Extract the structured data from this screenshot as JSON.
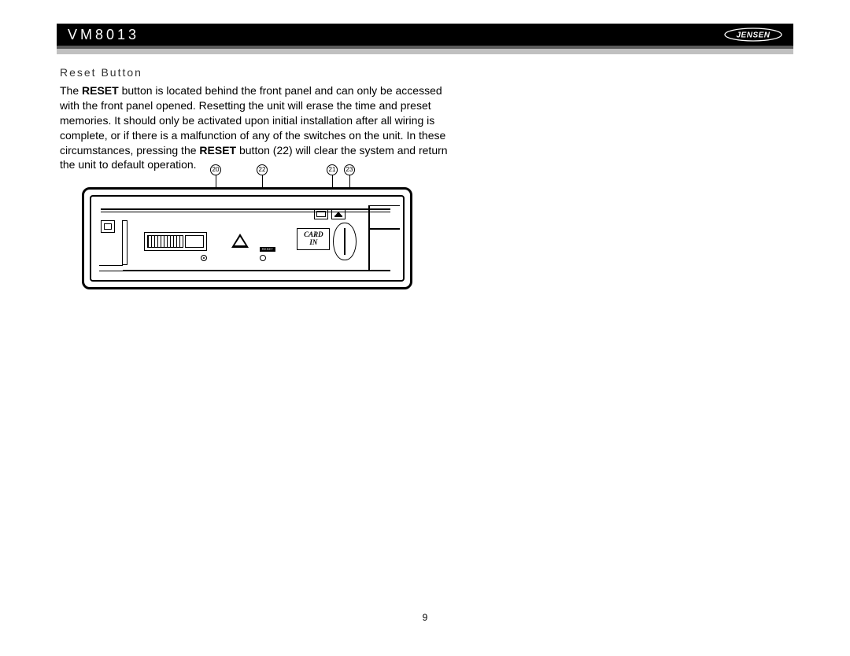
{
  "header": {
    "model": "VM8013",
    "brand": "JENSEN"
  },
  "section": {
    "heading": "Reset Button",
    "para_pre": "The ",
    "bold1": "RESET",
    "para_mid": " button is located behind the front panel and can only be accessed with the front panel opened. Resetting the unit will erase the time and preset memories. It should only be activated upon initial installation after all wiring is complete, or if there is a malfunction of any of the switches on the unit. In these circumstances, pressing the ",
    "bold2": "RESET",
    "para_post": " button (22) will clear the system and return the unit to default operation."
  },
  "diagram": {
    "callouts": {
      "a": "20",
      "b": "22",
      "c": "21",
      "d": "23"
    },
    "card_label_line1": "CARD",
    "card_label_line2": "IN",
    "reset_label": "RESET"
  },
  "page_number": "9"
}
